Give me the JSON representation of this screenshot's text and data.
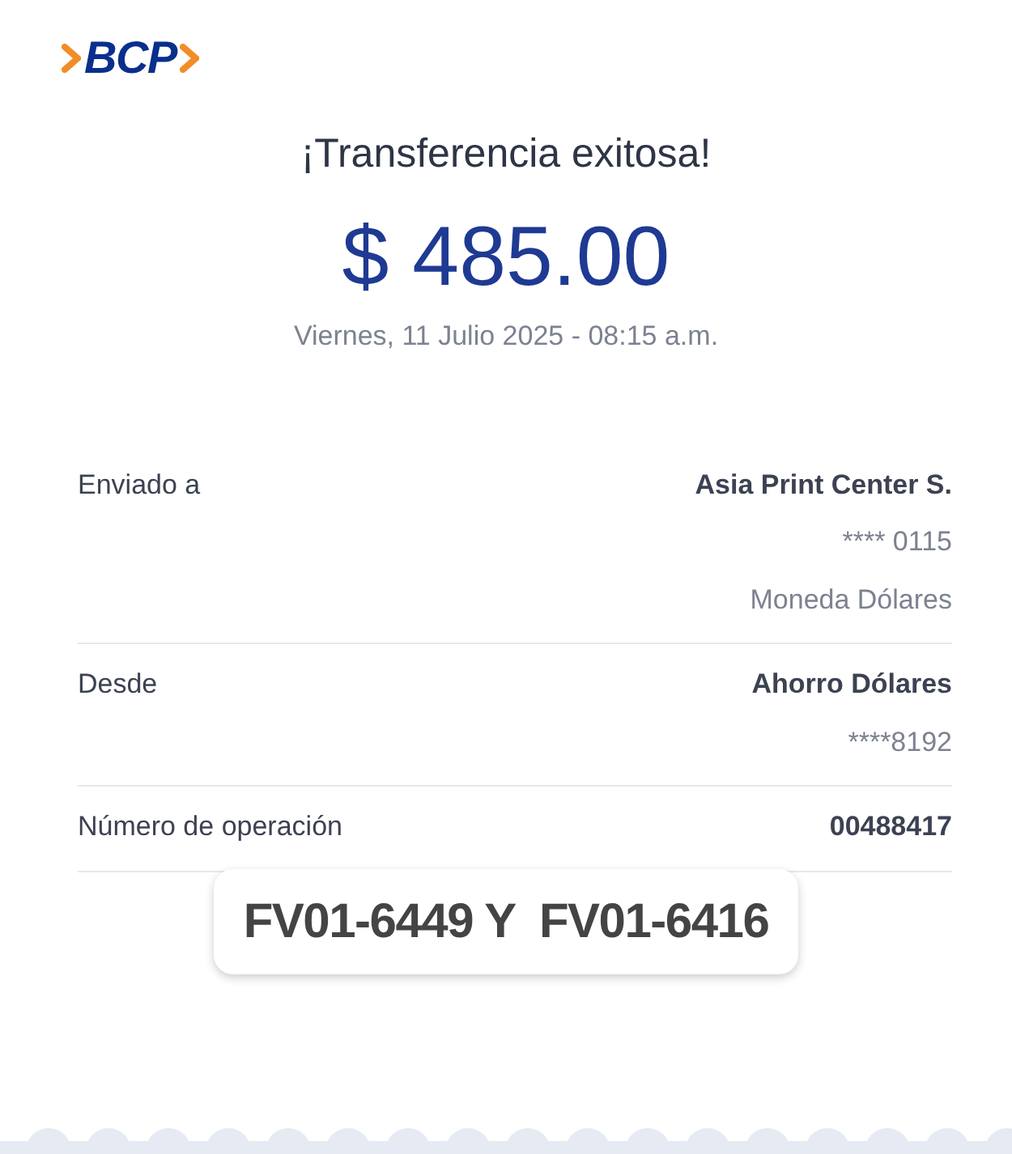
{
  "logo": {
    "text": "BCP"
  },
  "title": "¡Transferencia exitosa!",
  "amount": "$ 485.00",
  "date": "Viernes, 11 Julio 2025 - 08:15 a.m.",
  "details": [
    {
      "label": "Enviado a",
      "values": [
        "Asia Print Center S.",
        "**** 0115",
        "Moneda Dólares"
      ]
    },
    {
      "label": "Desde",
      "values": [
        "Ahorro Dólares",
        "****8192"
      ]
    },
    {
      "label": "Número de operación",
      "values": [
        "00488417"
      ]
    }
  ],
  "note": "FV01-6449 Y  FV01-6416"
}
